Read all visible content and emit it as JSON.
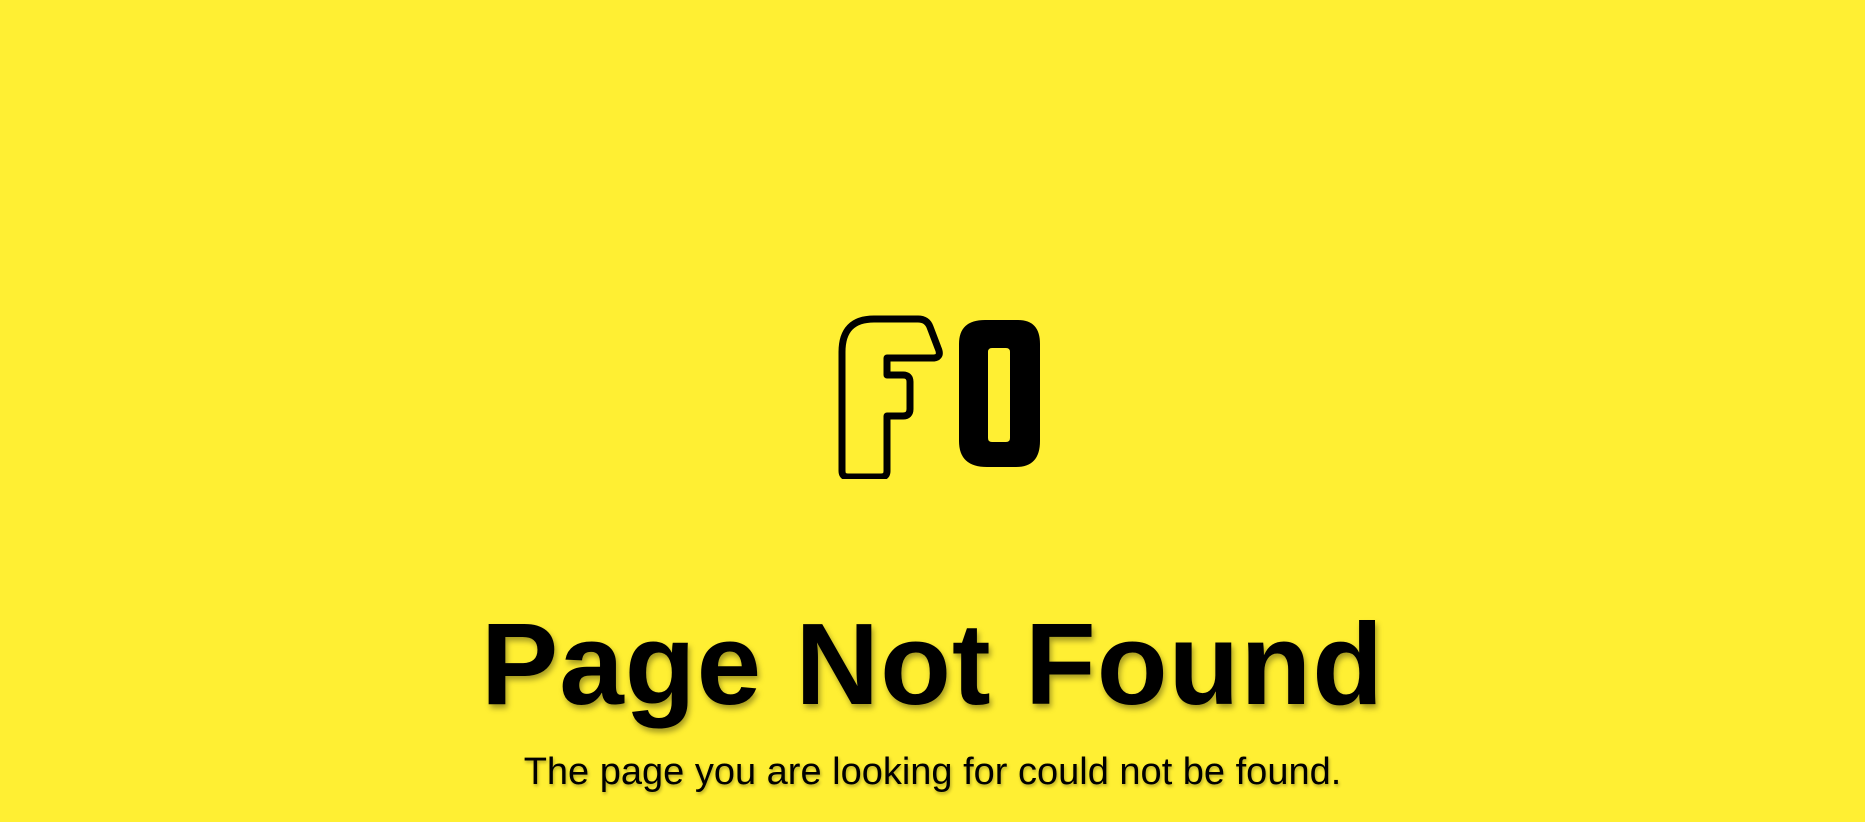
{
  "brand": {
    "logo_icon": "fo-logo-icon",
    "logo_text": "FO",
    "background_color": "#FFEF33",
    "ink_color": "#000000"
  },
  "error": {
    "title": "Page Not Found",
    "message": "The page you are looking for could not be found."
  }
}
